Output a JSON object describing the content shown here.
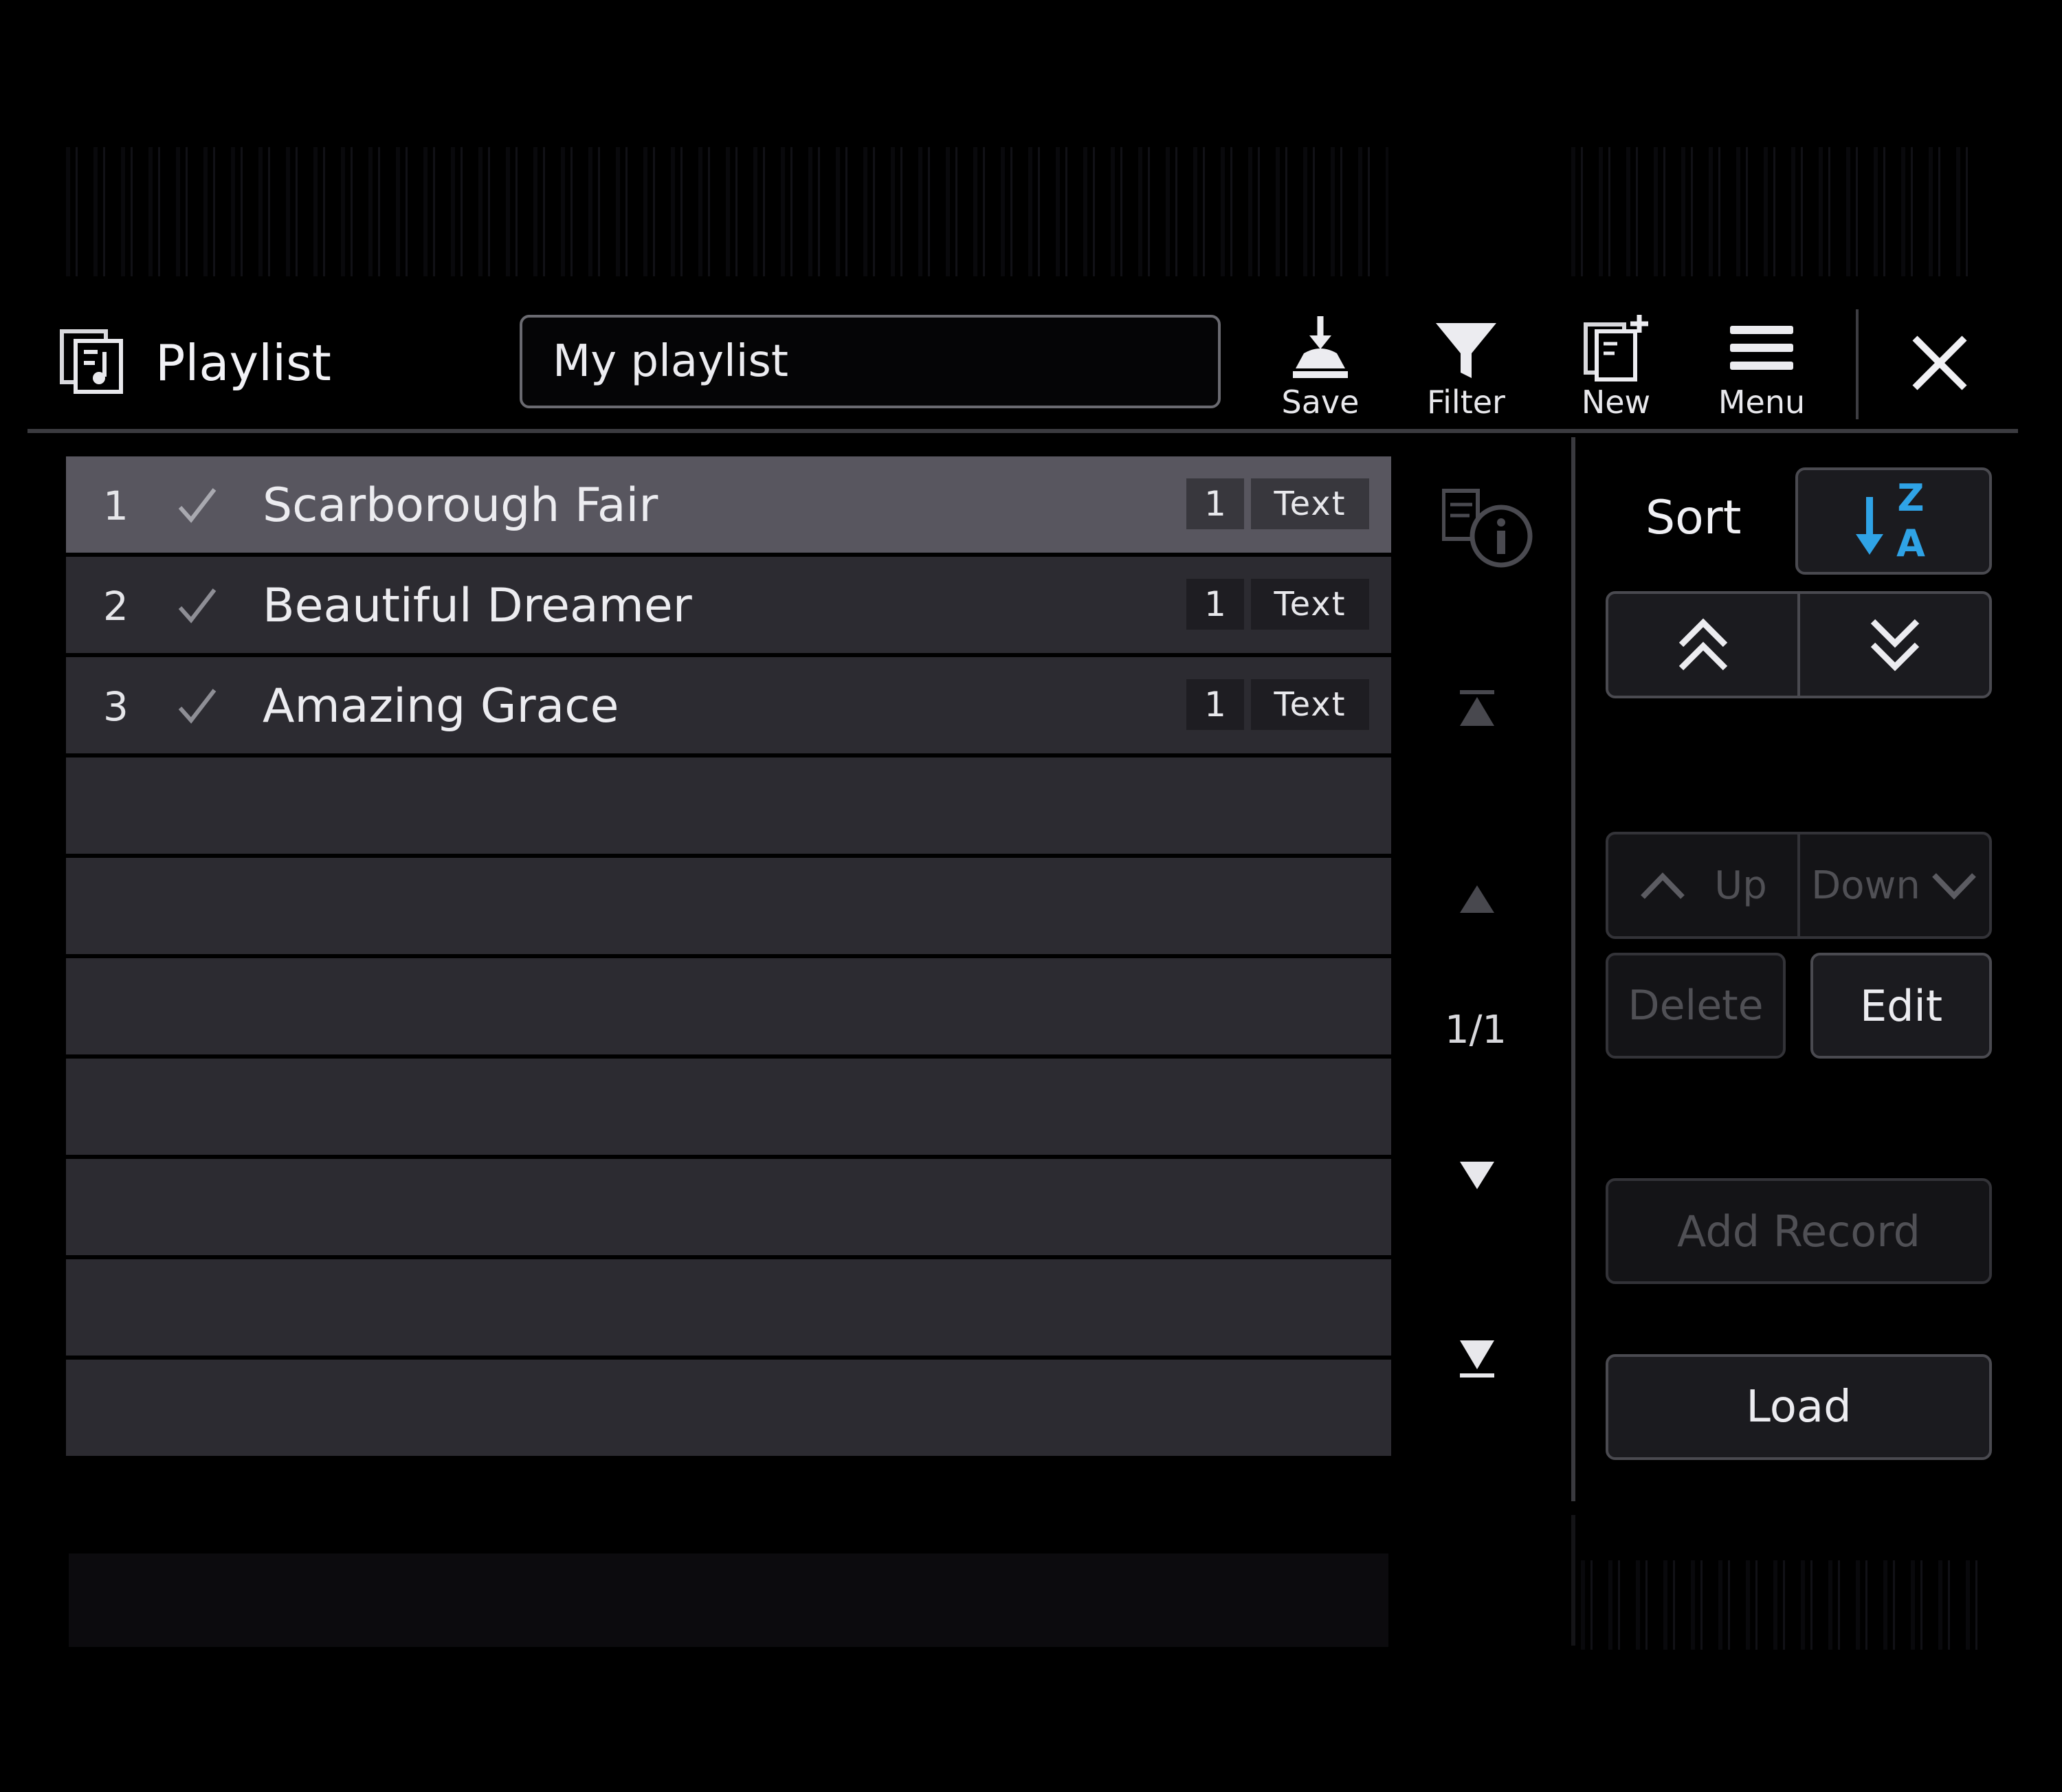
{
  "header": {
    "title": "Playlist",
    "playlist_name": "My playlist",
    "tools": [
      {
        "icon": "save-icon",
        "label": "Save"
      },
      {
        "icon": "filter-icon",
        "label": "Filter"
      },
      {
        "icon": "new-icon",
        "label": "New"
      },
      {
        "icon": "menu-icon",
        "label": "Menu"
      }
    ],
    "close_icon": "close-icon"
  },
  "records": [
    {
      "number": "1",
      "checked": true,
      "title": "Scarborough Fair",
      "badge_count": "1",
      "badge_type": "Text",
      "selected": true
    },
    {
      "number": "2",
      "checked": true,
      "title": "Beautiful Dreamer",
      "badge_count": "1",
      "badge_type": "Text",
      "selected": false
    },
    {
      "number": "3",
      "checked": true,
      "title": "Amazing Grace",
      "badge_count": "1",
      "badge_type": "Text",
      "selected": false
    }
  ],
  "empty_rows": 7,
  "pager": {
    "page_indicator": "1/1",
    "icons": [
      "record-info-icon",
      "first-page-icon",
      "page-up-icon",
      "page-down-icon",
      "last-page-icon"
    ]
  },
  "right_panel": {
    "sort_label": "Sort",
    "sort_icon": "sort-za-icon",
    "jump_top_icon": "double-chevron-up-icon",
    "jump_bottom_icon": "double-chevron-down-icon",
    "up_label": "Up",
    "down_label": "Down",
    "delete_label": "Delete",
    "edit_label": "Edit",
    "add_record_label": "Add Record",
    "load_label": "Load"
  },
  "colors": {
    "background": "#000000",
    "row": "#2c2b31",
    "row_selected": "#58565f",
    "sort_accent": "#2fa3e6",
    "disabled_text": "#505055"
  }
}
